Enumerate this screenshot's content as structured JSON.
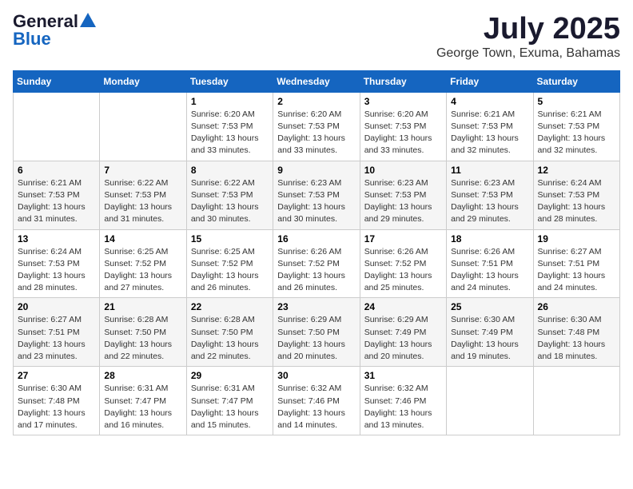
{
  "logo": {
    "general": "General",
    "blue": "Blue"
  },
  "title": "July 2025",
  "location": "George Town, Exuma, Bahamas",
  "days_of_week": [
    "Sunday",
    "Monday",
    "Tuesday",
    "Wednesday",
    "Thursday",
    "Friday",
    "Saturday"
  ],
  "weeks": [
    [
      {
        "day": "",
        "info": ""
      },
      {
        "day": "",
        "info": ""
      },
      {
        "day": "1",
        "info": "Sunrise: 6:20 AM\nSunset: 7:53 PM\nDaylight: 13 hours\nand 33 minutes."
      },
      {
        "day": "2",
        "info": "Sunrise: 6:20 AM\nSunset: 7:53 PM\nDaylight: 13 hours\nand 33 minutes."
      },
      {
        "day": "3",
        "info": "Sunrise: 6:20 AM\nSunset: 7:53 PM\nDaylight: 13 hours\nand 33 minutes."
      },
      {
        "day": "4",
        "info": "Sunrise: 6:21 AM\nSunset: 7:53 PM\nDaylight: 13 hours\nand 32 minutes."
      },
      {
        "day": "5",
        "info": "Sunrise: 6:21 AM\nSunset: 7:53 PM\nDaylight: 13 hours\nand 32 minutes."
      }
    ],
    [
      {
        "day": "6",
        "info": "Sunrise: 6:21 AM\nSunset: 7:53 PM\nDaylight: 13 hours\nand 31 minutes."
      },
      {
        "day": "7",
        "info": "Sunrise: 6:22 AM\nSunset: 7:53 PM\nDaylight: 13 hours\nand 31 minutes."
      },
      {
        "day": "8",
        "info": "Sunrise: 6:22 AM\nSunset: 7:53 PM\nDaylight: 13 hours\nand 30 minutes."
      },
      {
        "day": "9",
        "info": "Sunrise: 6:23 AM\nSunset: 7:53 PM\nDaylight: 13 hours\nand 30 minutes."
      },
      {
        "day": "10",
        "info": "Sunrise: 6:23 AM\nSunset: 7:53 PM\nDaylight: 13 hours\nand 29 minutes."
      },
      {
        "day": "11",
        "info": "Sunrise: 6:23 AM\nSunset: 7:53 PM\nDaylight: 13 hours\nand 29 minutes."
      },
      {
        "day": "12",
        "info": "Sunrise: 6:24 AM\nSunset: 7:53 PM\nDaylight: 13 hours\nand 28 minutes."
      }
    ],
    [
      {
        "day": "13",
        "info": "Sunrise: 6:24 AM\nSunset: 7:53 PM\nDaylight: 13 hours\nand 28 minutes."
      },
      {
        "day": "14",
        "info": "Sunrise: 6:25 AM\nSunset: 7:52 PM\nDaylight: 13 hours\nand 27 minutes."
      },
      {
        "day": "15",
        "info": "Sunrise: 6:25 AM\nSunset: 7:52 PM\nDaylight: 13 hours\nand 26 minutes."
      },
      {
        "day": "16",
        "info": "Sunrise: 6:26 AM\nSunset: 7:52 PM\nDaylight: 13 hours\nand 26 minutes."
      },
      {
        "day": "17",
        "info": "Sunrise: 6:26 AM\nSunset: 7:52 PM\nDaylight: 13 hours\nand 25 minutes."
      },
      {
        "day": "18",
        "info": "Sunrise: 6:26 AM\nSunset: 7:51 PM\nDaylight: 13 hours\nand 24 minutes."
      },
      {
        "day": "19",
        "info": "Sunrise: 6:27 AM\nSunset: 7:51 PM\nDaylight: 13 hours\nand 24 minutes."
      }
    ],
    [
      {
        "day": "20",
        "info": "Sunrise: 6:27 AM\nSunset: 7:51 PM\nDaylight: 13 hours\nand 23 minutes."
      },
      {
        "day": "21",
        "info": "Sunrise: 6:28 AM\nSunset: 7:50 PM\nDaylight: 13 hours\nand 22 minutes."
      },
      {
        "day": "22",
        "info": "Sunrise: 6:28 AM\nSunset: 7:50 PM\nDaylight: 13 hours\nand 22 minutes."
      },
      {
        "day": "23",
        "info": "Sunrise: 6:29 AM\nSunset: 7:50 PM\nDaylight: 13 hours\nand 20 minutes."
      },
      {
        "day": "24",
        "info": "Sunrise: 6:29 AM\nSunset: 7:49 PM\nDaylight: 13 hours\nand 20 minutes."
      },
      {
        "day": "25",
        "info": "Sunrise: 6:30 AM\nSunset: 7:49 PM\nDaylight: 13 hours\nand 19 minutes."
      },
      {
        "day": "26",
        "info": "Sunrise: 6:30 AM\nSunset: 7:48 PM\nDaylight: 13 hours\nand 18 minutes."
      }
    ],
    [
      {
        "day": "27",
        "info": "Sunrise: 6:30 AM\nSunset: 7:48 PM\nDaylight: 13 hours\nand 17 minutes."
      },
      {
        "day": "28",
        "info": "Sunrise: 6:31 AM\nSunset: 7:47 PM\nDaylight: 13 hours\nand 16 minutes."
      },
      {
        "day": "29",
        "info": "Sunrise: 6:31 AM\nSunset: 7:47 PM\nDaylight: 13 hours\nand 15 minutes."
      },
      {
        "day": "30",
        "info": "Sunrise: 6:32 AM\nSunset: 7:46 PM\nDaylight: 13 hours\nand 14 minutes."
      },
      {
        "day": "31",
        "info": "Sunrise: 6:32 AM\nSunset: 7:46 PM\nDaylight: 13 hours\nand 13 minutes."
      },
      {
        "day": "",
        "info": ""
      },
      {
        "day": "",
        "info": ""
      }
    ]
  ]
}
